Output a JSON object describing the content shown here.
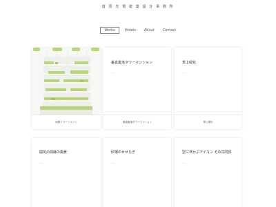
{
  "site": {
    "title": "首 原 光 規 建 築 設 計 事 務 所"
  },
  "nav": {
    "items": [
      {
        "label": "Works"
      },
      {
        "label": "Hotels"
      },
      {
        "label": "About"
      },
      {
        "label": "Contact"
      }
    ]
  },
  "cards": [
    {
      "title": "",
      "dash": "",
      "caption": "地層アパートメント"
    },
    {
      "title": "垂直集落タワーマンション",
      "dash": "—",
      "caption": "垂直集落タワーマンション"
    },
    {
      "title": "単上緑化",
      "dash": "—",
      "caption": "単上緑化"
    },
    {
      "title": "開花の間縁の風景",
      "dash": "—",
      "caption": ""
    },
    {
      "title": "砂場のせせらぎ",
      "dash": "—",
      "caption": ""
    },
    {
      "title": "空に浮かぶアイコン その共同体",
      "dash": "—",
      "caption": ""
    }
  ]
}
